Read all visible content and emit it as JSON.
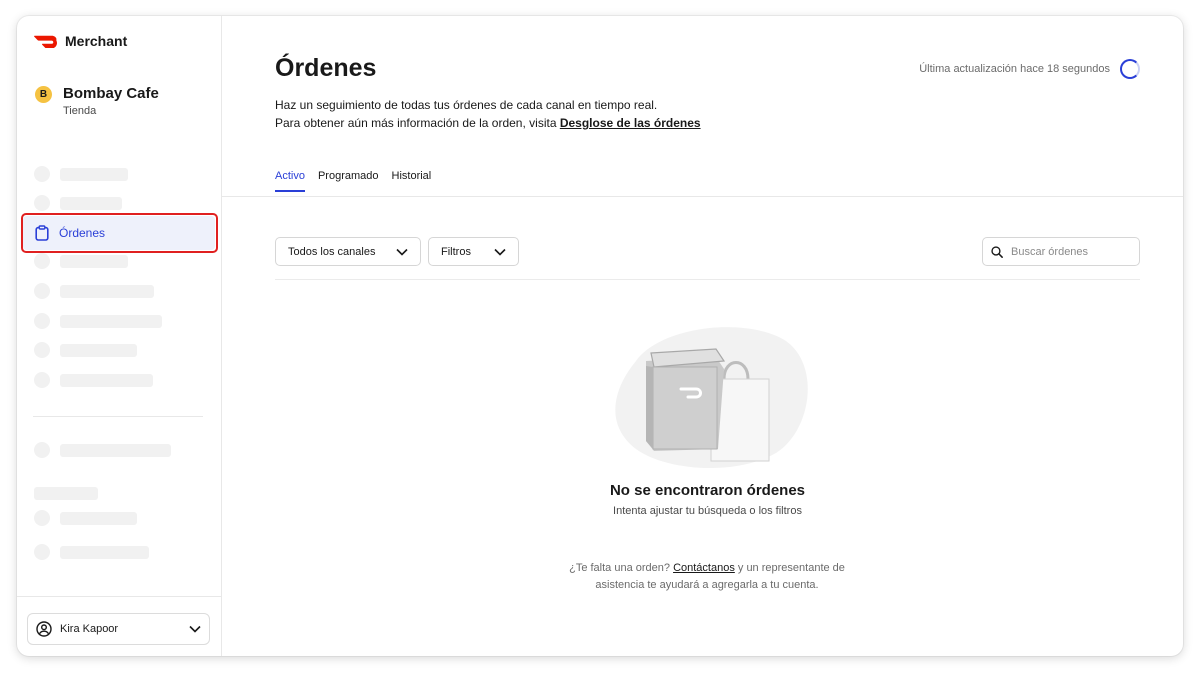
{
  "app": {
    "brand_name": "Merchant",
    "brand_color": "#eb1700",
    "accent_color": "#2a3fd7"
  },
  "store": {
    "initial": "B",
    "name": "Bombay Cafe",
    "type": "Tienda"
  },
  "sidebar": {
    "selected_item": {
      "label": "Órdenes",
      "icon": "clipboard-icon"
    },
    "loading_placeholders": 12
  },
  "user": {
    "name": "Kira Kapoor",
    "icon": "user-circle-icon"
  },
  "header": {
    "title": "Órdenes",
    "last_updated": "Última actualización hace 18 segundos",
    "description_line1": "Haz un seguimiento de todas tus órdenes de cada canal en tiempo real.",
    "description_line2_prefix": "Para obtener aún más información de la orden, visita ",
    "description_link": "Desglose de las órdenes"
  },
  "tabs": [
    {
      "label": "Activo",
      "active": true
    },
    {
      "label": "Programado",
      "active": false
    },
    {
      "label": "Historial",
      "active": false
    }
  ],
  "filters": {
    "channels_label": "Todos los canales",
    "filters_label": "Filtros",
    "search_placeholder": "Buscar órdenes"
  },
  "empty_state": {
    "title": "No se encontraron órdenes",
    "subtitle": "Intenta ajustar tu búsqueda o los filtros",
    "help_prefix": "¿Te falta una orden? ",
    "help_link": "Contáctanos",
    "help_suffix": " y un representante de asistencia te ayudará a agregarla a tu cuenta."
  }
}
